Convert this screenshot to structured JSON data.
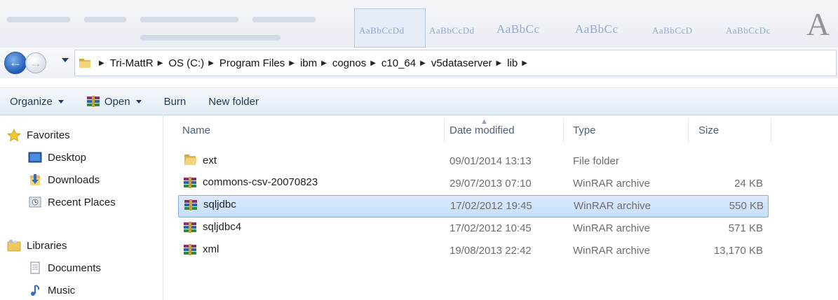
{
  "window": {
    "ribbon_style_labels": [
      "AaBbCcDd",
      "AaBbCcDd",
      "AaBbCc",
      "AaBbCc",
      "AaBbCcD",
      "AaBbCcDc"
    ]
  },
  "address_bar": {
    "breadcrumb": [
      "Tri-MattR",
      "OS (C:)",
      "Program Files",
      "ibm",
      "cognos",
      "c10_64",
      "v5dataserver",
      "lib"
    ]
  },
  "toolbar": {
    "organize": "Organize",
    "open": "Open",
    "burn": "Burn",
    "new_folder": "New folder"
  },
  "nav": {
    "favorites": "Favorites",
    "desktop": "Desktop",
    "downloads": "Downloads",
    "recent_places": "Recent Places",
    "libraries": "Libraries",
    "documents": "Documents",
    "music": "Music"
  },
  "columns": {
    "name": "Name",
    "date_modified": "Date modified",
    "type": "Type",
    "size": "Size"
  },
  "files": [
    {
      "name": "ext",
      "date": "09/01/2014 13:13",
      "type": "File folder",
      "size": "",
      "icon": "folder-icon"
    },
    {
      "name": "commons-csv-20070823",
      "date": "29/07/2013 07:10",
      "type": "WinRAR archive",
      "size": "24 KB",
      "icon": "winrar-archive-icon"
    },
    {
      "name": "sqljdbc",
      "date": "17/02/2012 19:45",
      "type": "WinRAR archive",
      "size": "550 KB",
      "icon": "winrar-archive-icon",
      "selected": true
    },
    {
      "name": "sqljdbc4",
      "date": "17/02/2012 10:45",
      "type": "WinRAR archive",
      "size": "571 KB",
      "icon": "winrar-archive-icon"
    },
    {
      "name": "xml",
      "date": "19/08/2013 22:42",
      "type": "WinRAR archive",
      "size": "13,170 KB",
      "icon": "winrar-archive-icon"
    }
  ],
  "colors": {
    "selection_bg": "#cce2fb",
    "toolbar_text": "#1e395b",
    "header_text": "#4c607a"
  }
}
